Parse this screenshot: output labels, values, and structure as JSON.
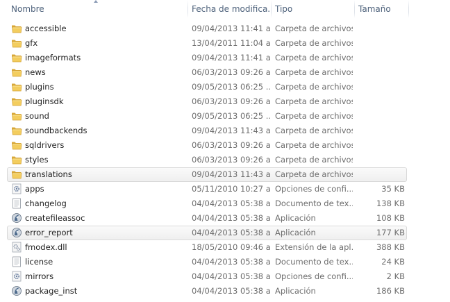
{
  "columns": {
    "name": "Nombre",
    "date": "Fecha de modifica...",
    "type": "Tipo",
    "size": "Tamaño"
  },
  "rows": [
    {
      "name": "accessible",
      "date": "09/04/2013 11:41 a...",
      "type": "Carpeta de archivos",
      "size": "",
      "icon": "folder-icon"
    },
    {
      "name": "gfx",
      "date": "13/04/2011 11:04 a...",
      "type": "Carpeta de archivos",
      "size": "",
      "icon": "folder-icon"
    },
    {
      "name": "imageformats",
      "date": "09/04/2013 11:41 a...",
      "type": "Carpeta de archivos",
      "size": "",
      "icon": "folder-icon"
    },
    {
      "name": "news",
      "date": "06/03/2013 09:26 a...",
      "type": "Carpeta de archivos",
      "size": "",
      "icon": "folder-icon"
    },
    {
      "name": "plugins",
      "date": "09/05/2013 06:25 ...",
      "type": "Carpeta de archivos",
      "size": "",
      "icon": "folder-icon"
    },
    {
      "name": "pluginsdk",
      "date": "06/03/2013 09:26 a...",
      "type": "Carpeta de archivos",
      "size": "",
      "icon": "folder-icon"
    },
    {
      "name": "sound",
      "date": "09/05/2013 06:25 ...",
      "type": "Carpeta de archivos",
      "size": "",
      "icon": "folder-icon"
    },
    {
      "name": "soundbackends",
      "date": "09/04/2013 11:43 a...",
      "type": "Carpeta de archivos",
      "size": "",
      "icon": "folder-icon"
    },
    {
      "name": "sqldrivers",
      "date": "06/03/2013 09:26 a...",
      "type": "Carpeta de archivos",
      "size": "",
      "icon": "folder-icon"
    },
    {
      "name": "styles",
      "date": "06/03/2013 09:26 a...",
      "type": "Carpeta de archivos",
      "size": "",
      "icon": "folder-icon"
    },
    {
      "name": "translations",
      "date": "09/04/2013 11:43 a...",
      "type": "Carpeta de archivos",
      "size": "",
      "icon": "folder-icon",
      "selected": true
    },
    {
      "name": "apps",
      "date": "05/11/2010 10:27 a...",
      "type": "Opciones de confi...",
      "size": "35 KB",
      "icon": "settings-file-icon"
    },
    {
      "name": "changelog",
      "date": "04/04/2013 05:38 a...",
      "type": "Documento de tex...",
      "size": "138 KB",
      "icon": "text-document-icon"
    },
    {
      "name": "createfileassoc",
      "date": "04/04/2013 05:38 a...",
      "type": "Aplicación",
      "size": "108 KB",
      "icon": "application-icon"
    },
    {
      "name": "error_report",
      "date": "04/04/2013 05:38 a...",
      "type": "Aplicación",
      "size": "177 KB",
      "icon": "application-icon",
      "selected": true
    },
    {
      "name": "fmodex.dll",
      "date": "18/05/2010 09:46 a...",
      "type": "Extensión de la apl...",
      "size": "388 KB",
      "icon": "dll-file-icon"
    },
    {
      "name": "license",
      "date": "04/04/2013 05:38 a...",
      "type": "Documento de tex...",
      "size": "24 KB",
      "icon": "text-document-icon"
    },
    {
      "name": "mirrors",
      "date": "04/04/2013 05:38 a...",
      "type": "Opciones de confi...",
      "size": "2 KB",
      "icon": "settings-file-icon"
    },
    {
      "name": "package_inst",
      "date": "04/04/2013 05:38 a...",
      "type": "Aplicación",
      "size": "186 KB",
      "icon": "application-icon"
    }
  ]
}
